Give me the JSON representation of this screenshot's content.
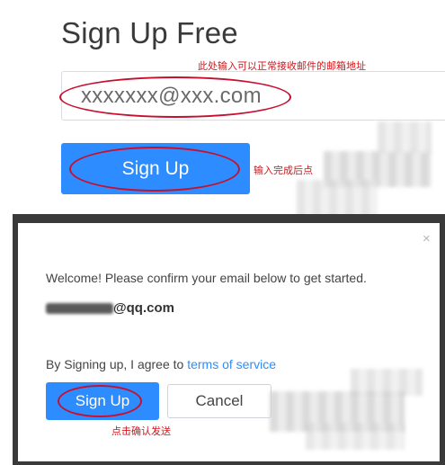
{
  "form": {
    "title": "Sign Up Free",
    "email_value": "xxxxxxx@xxx.com",
    "signup_label": "Sign Up"
  },
  "annotations": {
    "email_note": "此处输入可以正常接收邮件的邮箱地址",
    "signup_note": "输入完成后点",
    "confirm_note": "点击确认发送"
  },
  "dialog": {
    "close_label": "×",
    "welcome_text": "Welcome! Please confirm your email below to get started.",
    "email_domain": "@qq.com",
    "agree_text": "By Signing up, I agree to ",
    "tos_link": "terms of service",
    "signup_label": "Sign Up",
    "cancel_label": "Cancel"
  },
  "colors": {
    "accent": "#2d8cff",
    "annotation_red": "#c8102e"
  }
}
